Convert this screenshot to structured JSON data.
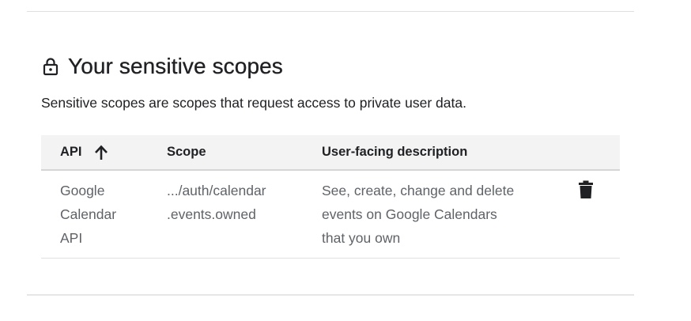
{
  "section": {
    "icon": "lock-icon",
    "title": "Your sensitive scopes",
    "description": "Sensitive scopes are scopes that request access to private user data."
  },
  "table": {
    "columns": [
      {
        "label": "API",
        "sort": "ascending",
        "sort_icon": "arrow-up-icon"
      },
      {
        "label": "Scope"
      },
      {
        "label": "User-facing description"
      }
    ],
    "rows": [
      {
        "api": [
          "Google",
          "Calendar",
          "API"
        ],
        "scope": [
          ".../auth/calendar",
          ".events.owned"
        ],
        "description": [
          "See, create, change and delete",
          "events on Google Calendars",
          "that you own"
        ],
        "action_icon": "trash-icon"
      }
    ]
  }
}
